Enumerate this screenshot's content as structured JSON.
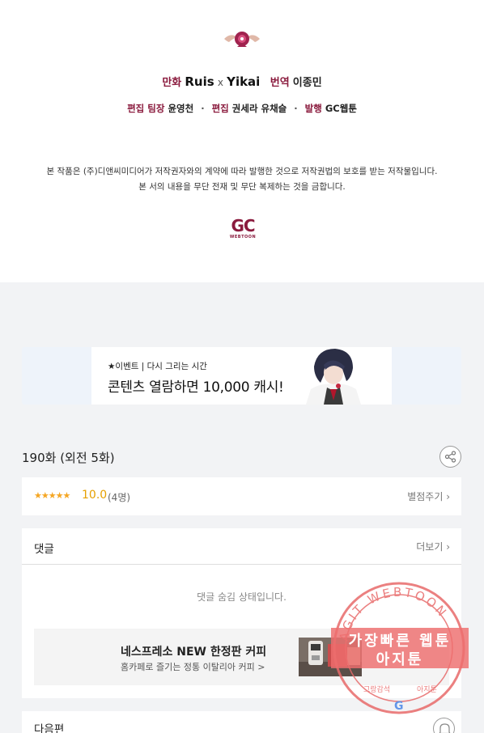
{
  "credits": {
    "manhwa_label": "만화",
    "manhwa_value": "Ruis",
    "cross": "x",
    "manhwa_value2": "Yikai",
    "translation_label": "번역",
    "translation_value": "이종민",
    "editor_lead_label": "편집 팀장",
    "editor_lead_value": "윤영천",
    "editor_label": "편집",
    "editor_value": "권세라 유채슬",
    "publisher_label": "발행",
    "publisher_value": "GC웹툰",
    "separator": "·",
    "notice_line1": "본 작품은 (주)디앤씨미디어가 저작권자와의 계약에 따라 발행한 것으로 저작권법의 보호를 받는 저작물입니다.",
    "notice_line2": "본 서의 내용을 무단 전재 및 무단 복제하는 것을 금합니다.",
    "logo_text": "GC",
    "logo_subtext": "WEBTOON"
  },
  "banner": {
    "small_text": "★이벤트 | 다시 그리는 시간",
    "big_text": "콘텐츠 열람하면 10,000 캐시!"
  },
  "episode": {
    "title": "190화 (외전 5화)"
  },
  "rating": {
    "stars": "★★★★★",
    "score": "10.0",
    "count": "(4명)",
    "rate_button": "별점주기 ›"
  },
  "comments": {
    "title": "댓글",
    "more_button": "더보기 ›",
    "hidden_message": "댓글 숨김 상태입니다."
  },
  "ad": {
    "title": "네스프레소 NEW 한정판 커피",
    "subtitle": "홈카페로 즐기는 정통 이탈리아 커피 >"
  },
  "next": {
    "title": "다음편"
  },
  "watermark": {
    "arc_text": "AGIT WEBTOON",
    "line1": "가장빠른 웹툰",
    "line2": "아지툰",
    "bottom_left": "그랑감석",
    "bottom_right": "아지툰",
    "g_letter": "G"
  },
  "colors": {
    "brand": "#8a1a3d",
    "star": "#f5a623",
    "watermark": "#e86a6a"
  }
}
